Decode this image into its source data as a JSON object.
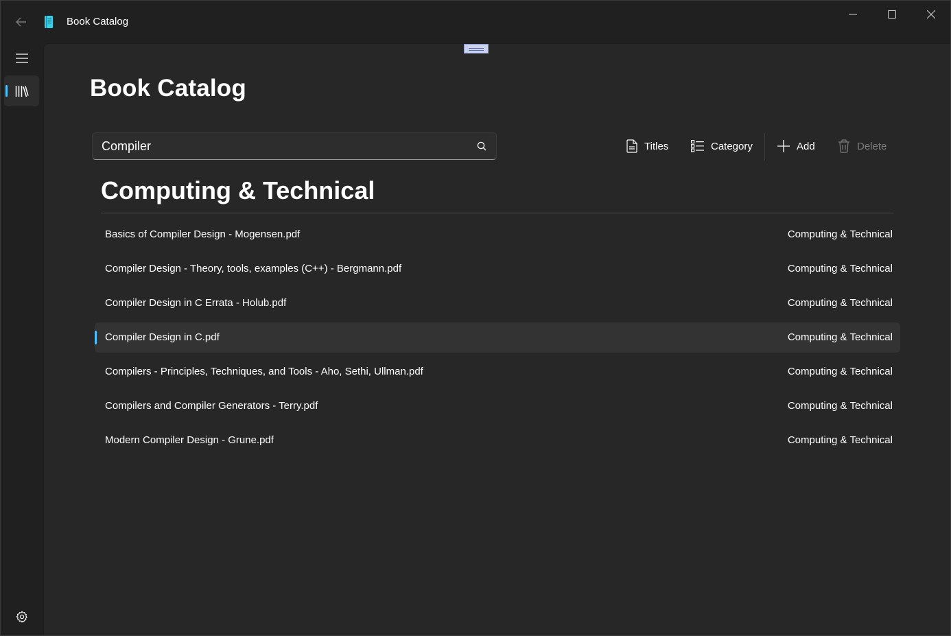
{
  "window": {
    "title": "Book Catalog"
  },
  "page": {
    "title": "Book Catalog"
  },
  "search": {
    "value": "Compiler"
  },
  "toolbar": {
    "titles_label": "Titles",
    "category_label": "Category",
    "add_label": "Add",
    "delete_label": "Delete"
  },
  "group": {
    "header": "Computing & Technical"
  },
  "books": [
    {
      "title": "Basics of Compiler Design - Mogensen.pdf",
      "category": "Computing & Technical",
      "selected": false
    },
    {
      "title": "Compiler Design - Theory, tools, examples (C++) - Bergmann.pdf",
      "category": "Computing & Technical",
      "selected": false
    },
    {
      "title": "Compiler Design in C Errata - Holub.pdf",
      "category": "Computing & Technical",
      "selected": false
    },
    {
      "title": "Compiler Design in C.pdf",
      "category": "Computing & Technical",
      "selected": true
    },
    {
      "title": "Compilers - Principles, Techniques, and Tools - Aho, Sethi, Ullman.pdf",
      "category": "Computing & Technical",
      "selected": false
    },
    {
      "title": "Compilers and Compiler Generators - Terry.pdf",
      "category": "Computing & Technical",
      "selected": false
    },
    {
      "title": "Modern Compiler Design - Grune.pdf",
      "category": "Computing & Technical",
      "selected": false
    }
  ],
  "icons": {
    "back": "back-arrow-icon",
    "app": "book-icon",
    "minimize": "minimize-icon",
    "maximize": "maximize-icon",
    "close": "close-icon",
    "menu": "hamburger-icon",
    "library": "library-icon",
    "settings": "gear-icon",
    "search": "search-icon",
    "titles": "document-icon",
    "category": "list-icon",
    "add": "plus-icon",
    "delete": "trash-icon"
  },
  "colors": {
    "accent": "#4cc2ff",
    "app_icon": "#3ad0e8",
    "background": "#202020",
    "content": "#272727"
  }
}
